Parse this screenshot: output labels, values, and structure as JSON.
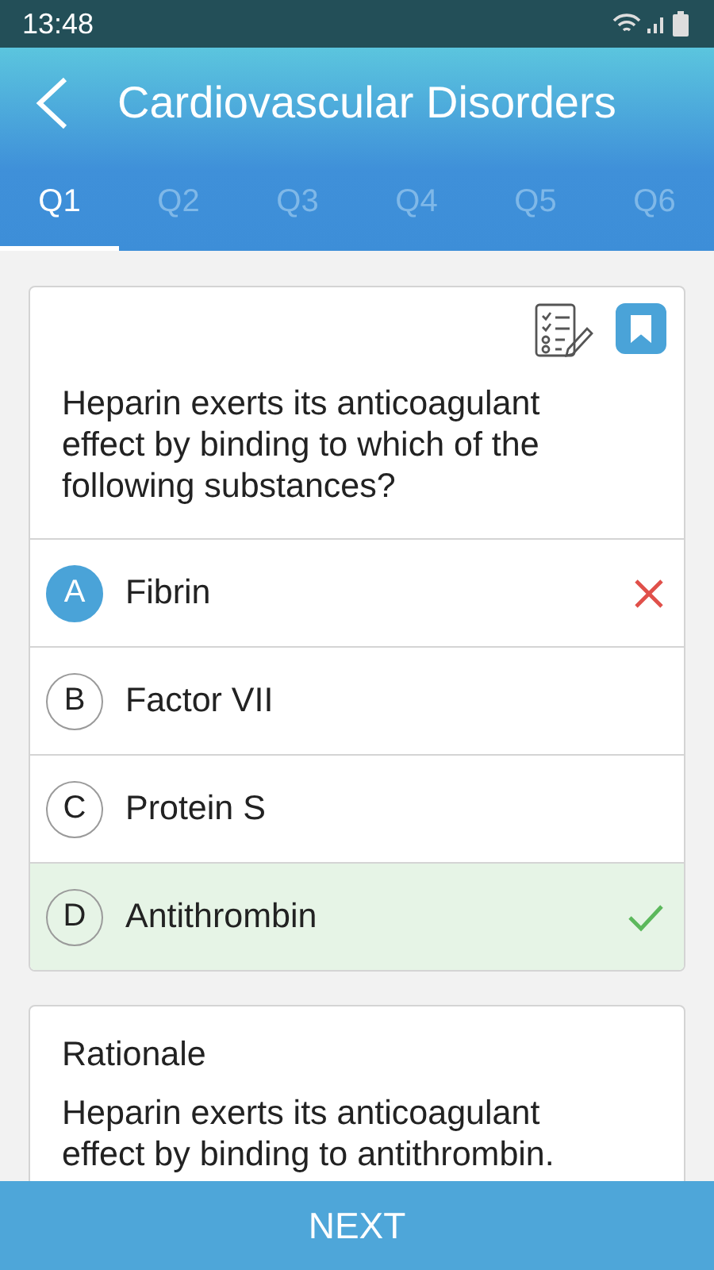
{
  "status_bar": {
    "time": "13:48"
  },
  "header": {
    "title": "Cardiovascular Disorders"
  },
  "tabs": [
    {
      "label": "Q1",
      "selected": true
    },
    {
      "label": "Q2",
      "selected": false
    },
    {
      "label": "Q3",
      "selected": false
    },
    {
      "label": "Q4",
      "selected": false
    },
    {
      "label": "Q5",
      "selected": false
    },
    {
      "label": "Q6",
      "selected": false
    }
  ],
  "question": {
    "text": "Heparin exerts its anticoagulant effect by binding to which of the following substances?",
    "bookmarked": true
  },
  "options": [
    {
      "letter": "A",
      "text": "Fibrin",
      "selected": true,
      "wrong": true,
      "correct": false
    },
    {
      "letter": "B",
      "text": "Factor VII",
      "selected": false,
      "wrong": false,
      "correct": false
    },
    {
      "letter": "C",
      "text": "Protein S",
      "selected": false,
      "wrong": false,
      "correct": false
    },
    {
      "letter": "D",
      "text": "Antithrombin",
      "selected": false,
      "wrong": false,
      "correct": true
    }
  ],
  "rationale": {
    "heading": "Rationale",
    "text": "Heparin exerts its anticoagulant effect by binding to antithrombin."
  },
  "next_button": {
    "label": "NEXT"
  }
}
